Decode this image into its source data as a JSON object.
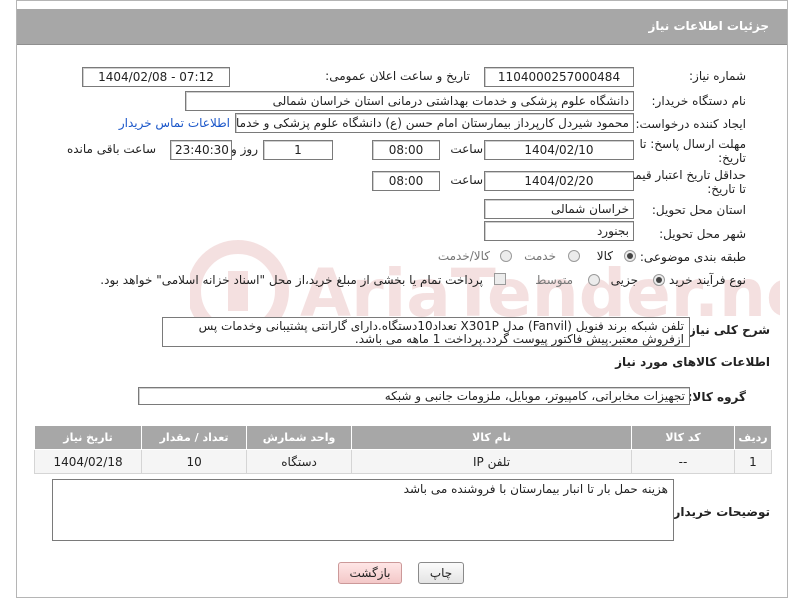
{
  "header": {
    "title": "جزئیات اطلاعات نیاز"
  },
  "form": {
    "need_number": {
      "label": "شماره نیاز:",
      "value": "1104000257000484"
    },
    "announce_datetime": {
      "label": "تاریخ و ساعت اعلان عمومی:",
      "value": "1404/02/08 - 07:12"
    },
    "buyer_org": {
      "label": "نام دستگاه خریدار:",
      "value": "دانشگاه علوم پزشکی و خدمات بهداشتی درمانی استان خراسان شمالی"
    },
    "requester": {
      "label": "ایجاد کننده درخواست:",
      "value": "محمود شیردل کارپرداز بیمارستان امام حسن (ع) دانشگاه علوم پزشکی و خدمات",
      "contact_link": "اطلاعات تماس خریدار"
    },
    "reply_deadline": {
      "label_line1": "مهلت ارسال پاسخ: تا",
      "label_line2": "تاریخ:",
      "date": "1404/02/10",
      "time_label": "ساعت",
      "time": "08:00",
      "days": "1",
      "days_label": "روز و",
      "remaining": "23:40:30",
      "remaining_label": "ساعت باقی مانده"
    },
    "price_validity": {
      "label_line1": "حداقل تاریخ اعتبار قیمت:",
      "label_line2": "تا تاریخ:",
      "date": "1404/02/20",
      "time_label": "ساعت",
      "time": "08:00"
    },
    "delivery_province": {
      "label": "استان محل تحویل:",
      "value": "خراسان شمالی"
    },
    "delivery_city": {
      "label": "شهر محل تحویل:",
      "value": "بجنورد"
    },
    "category": {
      "label": "طبقه بندی موضوعی:",
      "options": [
        "کالا",
        "خدمت",
        "کالا/خدمت"
      ],
      "selected": "کالا"
    },
    "purchase_process": {
      "label": "نوع فرآیند خرید :",
      "options": [
        "جزیی",
        "متوسط"
      ],
      "selected": "جزیی",
      "note": "پرداخت تمام یا بخشی از مبلغ خرید،از محل \"اسناد خزانه اسلامی\" خواهد بود."
    }
  },
  "description": {
    "label": "شرح کلی نیاز:",
    "text": "تلفن شبکه برند فنویل (Fanvil) مدل X301P تعداد10دستگاه.دارای گارانتی پشتیبانی وخدمات پس ازفروش معتبر.پیش فاکتور پیوست گردد.پرداخت 1 ماهه می باشد."
  },
  "goods_section": {
    "title": "اطلاعات کالاهای مورد نیاز",
    "group_label": "گروه کالا:",
    "group_value": "تجهیزات مخابراتی، کامپیوتر، موبایل، ملزومات جانبی و شبکه"
  },
  "table": {
    "headers": [
      "ردیف",
      "کد کالا",
      "نام کالا",
      "واحد شمارش",
      "تعداد / مقدار",
      "تاریخ نیاز"
    ],
    "rows": [
      [
        "1",
        "--",
        "تلفن IP",
        "دستگاه",
        "10",
        "1404/02/18"
      ]
    ]
  },
  "buyer_notes": {
    "label": "توضیحات خریدار:",
    "text": "هزینه حمل بار تا انبار بیمارستان با فروشنده می باشد"
  },
  "buttons": {
    "print": "چاپ",
    "back": "بازگشت"
  }
}
